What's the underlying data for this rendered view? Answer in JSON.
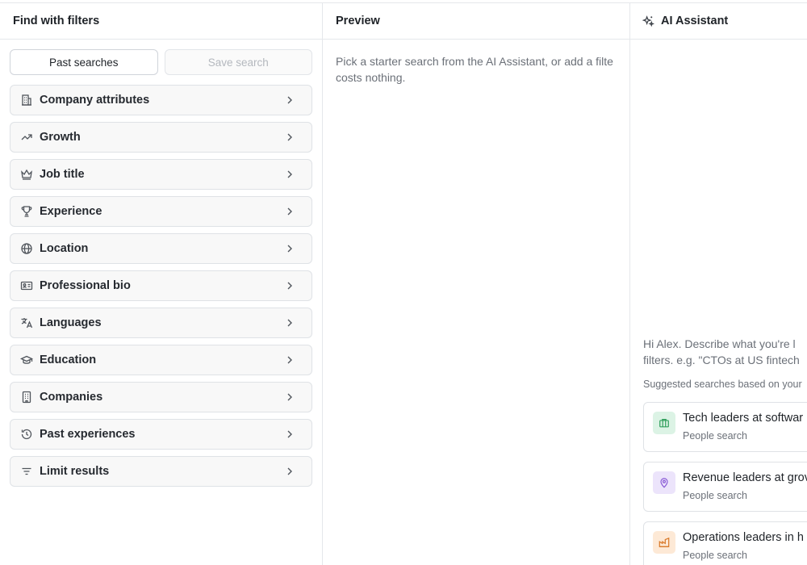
{
  "left_panel": {
    "title": "Find with filters",
    "past_searches_label": "Past searches",
    "save_search_label": "Save search",
    "filters": [
      {
        "label": "Company attributes",
        "icon": "building-icon"
      },
      {
        "label": "Growth",
        "icon": "trending-up-icon"
      },
      {
        "label": "Job title",
        "icon": "crown-icon"
      },
      {
        "label": "Experience",
        "icon": "trophy-icon"
      },
      {
        "label": "Location",
        "icon": "globe-icon"
      },
      {
        "label": "Professional bio",
        "icon": "id-card-icon"
      },
      {
        "label": "Languages",
        "icon": "translate-icon"
      },
      {
        "label": "Education",
        "icon": "graduation-cap-icon"
      },
      {
        "label": "Companies",
        "icon": "office-building-icon"
      },
      {
        "label": "Past experiences",
        "icon": "history-icon"
      },
      {
        "label": "Limit results",
        "icon": "filter-lines-icon"
      }
    ]
  },
  "preview_panel": {
    "title": "Preview",
    "line1": "Pick a starter search from the AI Assistant, or add a filte",
    "line2": "costs nothing."
  },
  "assistant_panel": {
    "title": "AI Assistant",
    "greeting_line1": "Hi Alex. Describe what you're l",
    "greeting_line2": "filters. e.g. \"CTOs at US fintech",
    "suggested_label": "Suggested searches based on your",
    "suggestions": [
      {
        "title": "Tech leaders at softwar",
        "subtitle": "People search",
        "icon": "briefcase-icon",
        "color": "#2f9e5b",
        "bg": "#dcf3e5"
      },
      {
        "title": "Revenue leaders at grov",
        "subtitle": "People search",
        "icon": "map-pin-icon",
        "color": "#8a5cd6",
        "bg": "#ece4fb"
      },
      {
        "title": "Operations leaders in h",
        "subtitle": "People search",
        "icon": "factory-icon",
        "color": "#d97a2b",
        "bg": "#fde9d6"
      }
    ]
  }
}
